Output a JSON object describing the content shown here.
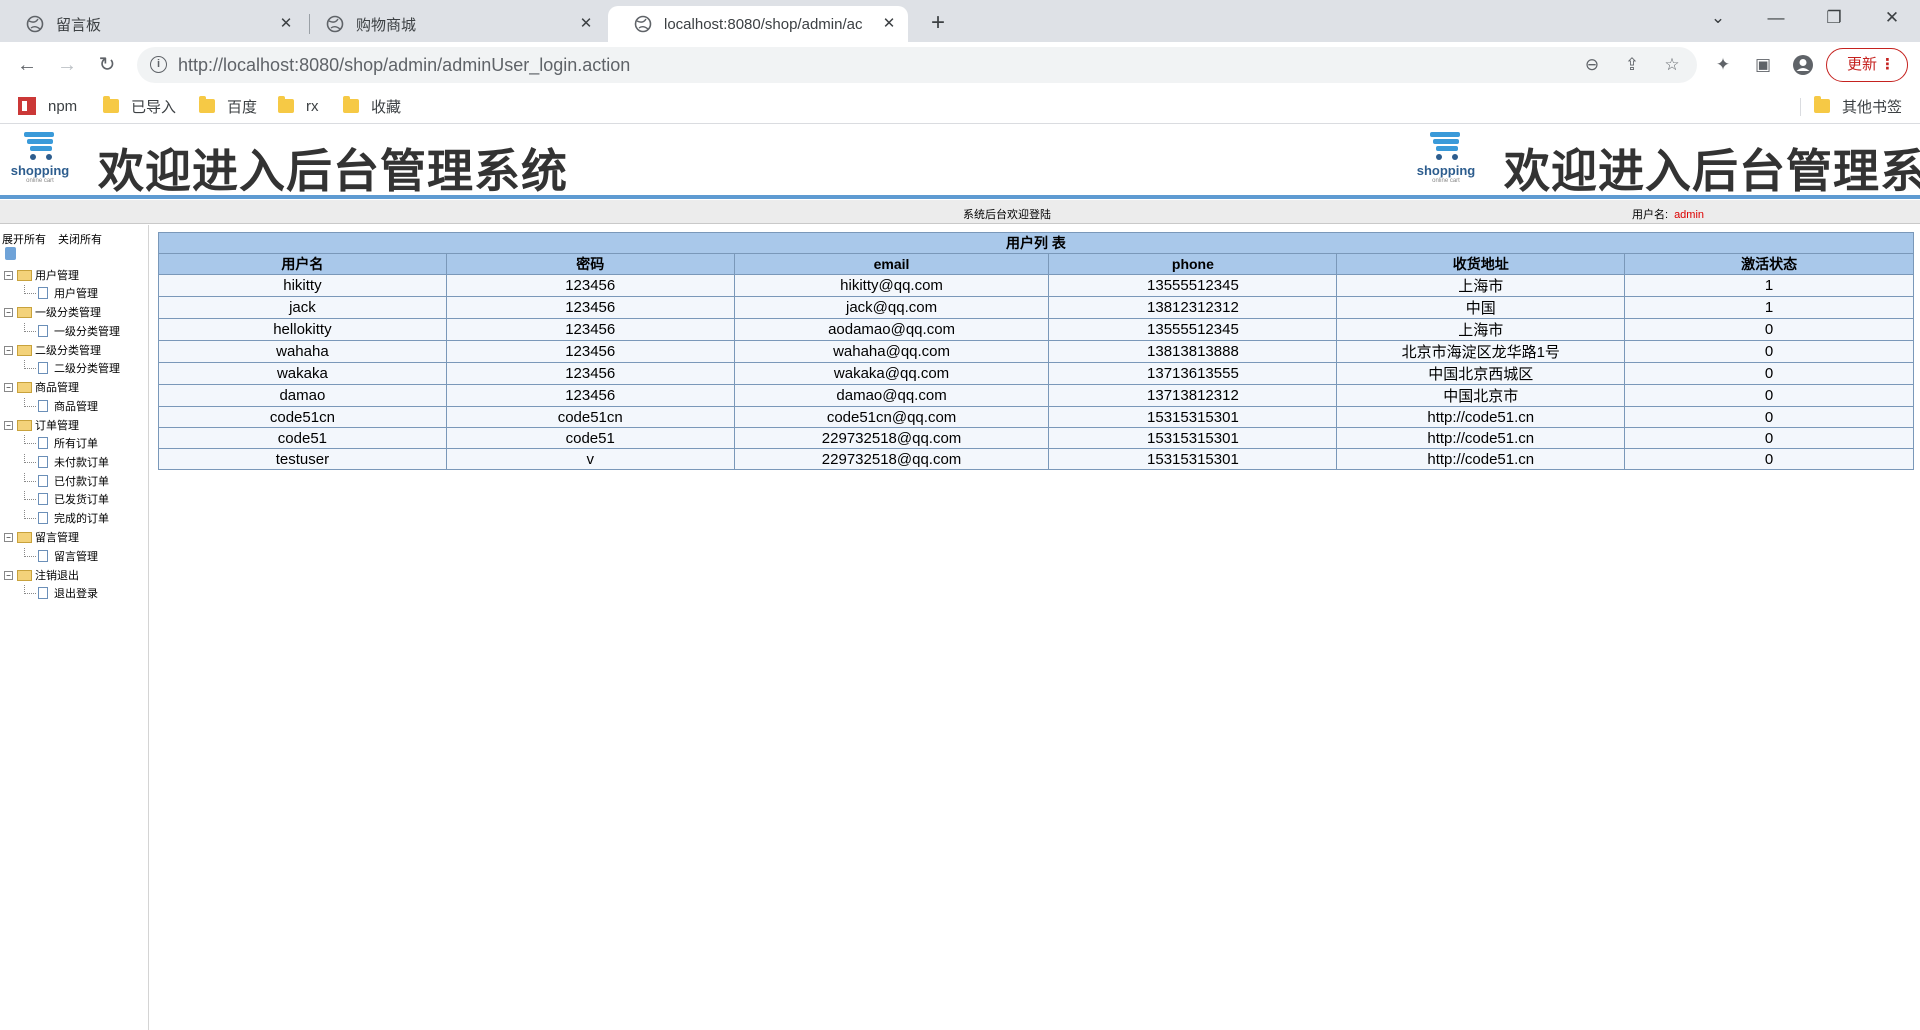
{
  "browser": {
    "tabs": [
      {
        "title": "留言板",
        "active": false
      },
      {
        "title": "购物商城",
        "active": false
      },
      {
        "title": "localhost:8080/shop/admin/ac",
        "active": true
      }
    ],
    "url_host": "http://localhost:8080",
    "url_path": "/shop/admin/adminUser_login.action",
    "update_label": "更新",
    "bookmarks": [
      "npm",
      "已导入",
      "百度",
      "rx",
      "收藏"
    ],
    "other_bookmarks": "其他书签"
  },
  "banner": {
    "logo_word": "shopping",
    "logo_sub": "online cart",
    "title": "欢迎进入后台管理系统"
  },
  "status": {
    "welcome": "系统后台欢迎登陆",
    "user_label": "用户名:",
    "user_name": "admin"
  },
  "sidebar": {
    "expand_all": "展开所有",
    "collapse_all": "关闭所有",
    "groups": [
      {
        "label": "用户管理",
        "items": [
          "用户管理"
        ]
      },
      {
        "label": "一级分类管理",
        "items": [
          "一级分类管理"
        ]
      },
      {
        "label": "二级分类管理",
        "items": [
          "二级分类管理"
        ]
      },
      {
        "label": "商品管理",
        "items": [
          "商品管理"
        ]
      },
      {
        "label": "订单管理",
        "items": [
          "所有订单",
          "未付款订单",
          "已付款订单",
          "已发货订单",
          "完成的订单"
        ]
      },
      {
        "label": "留言管理",
        "items": [
          "留言管理"
        ]
      },
      {
        "label": "注销退出",
        "items": [
          "退出登录"
        ]
      }
    ]
  },
  "table": {
    "caption": "用户列 表",
    "columns": [
      "用户名",
      "密码",
      "email",
      "phone",
      "收货地址",
      "激活状态"
    ],
    "rows": [
      [
        "hikitty",
        "123456",
        "hikitty@qq.com",
        "13555512345",
        "上海市",
        "1"
      ],
      [
        "jack",
        "123456",
        "jack@qq.com",
        "13812312312",
        "中国",
        "1"
      ],
      [
        "hellokitty",
        "123456",
        "aodamao@qq.com",
        "13555512345",
        "上海市",
        "0"
      ],
      [
        "wahaha",
        "123456",
        "wahaha@qq.com",
        "13813813888",
        "北京市海淀区龙华路1号",
        "0"
      ],
      [
        "wakaka",
        "123456",
        "wakaka@qq.com",
        "13713613555",
        "中国北京西城区",
        "0"
      ],
      [
        "damao",
        "123456",
        "damao@qq.com",
        "13713812312",
        "中国北京市",
        "0"
      ],
      [
        "code51cn",
        "code51cn",
        "code51cn@qq.com",
        "15315315301",
        "http://code51.cn",
        "0"
      ],
      [
        "code51",
        "code51",
        "229732518@qq.com",
        "15315315301",
        "http://code51.cn",
        "0"
      ],
      [
        "testuser",
        "v",
        "229732518@qq.com",
        "15315315301",
        "http://code51.cn",
        "0"
      ]
    ]
  },
  "colors": {
    "header_blue": "#a9c8ea",
    "banner_line": "#5e9bd2",
    "admin_red": "#dd0000"
  }
}
